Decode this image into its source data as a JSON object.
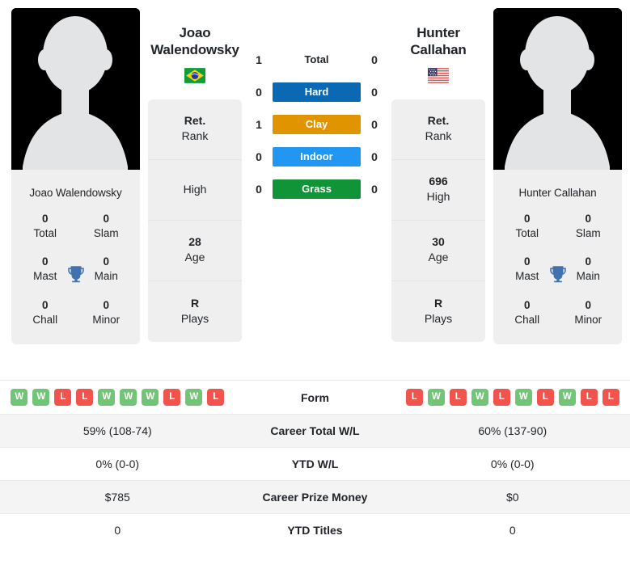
{
  "players": {
    "left": {
      "name": "Joao Walendowsky",
      "first_name": "Joao",
      "last_name": "Walendowsky",
      "country": "Brazil",
      "flag_icon": "flag-brazil-icon",
      "photo_icon": "player-silhouette-icon",
      "trophies": [
        {
          "value": "0",
          "label": "Total"
        },
        {
          "value": "0",
          "label": "Slam"
        },
        {
          "value": "0",
          "label": "Mast"
        },
        {
          "value": "0",
          "label": "Main"
        },
        {
          "value": "0",
          "label": "Chall"
        },
        {
          "value": "0",
          "label": "Minor"
        }
      ],
      "stats": [
        {
          "value": "Ret.",
          "label": "Rank"
        },
        {
          "value": "",
          "label": "High"
        },
        {
          "value": "28",
          "label": "Age"
        },
        {
          "value": "R",
          "label": "Plays"
        }
      ],
      "form": [
        "W",
        "W",
        "L",
        "L",
        "W",
        "W",
        "W",
        "L",
        "W",
        "L"
      ]
    },
    "right": {
      "name": "Hunter Callahan",
      "first_name": "Hunter",
      "last_name": "Callahan",
      "country": "United States",
      "flag_icon": "flag-usa-icon",
      "photo_icon": "player-silhouette-icon",
      "trophies": [
        {
          "value": "0",
          "label": "Total"
        },
        {
          "value": "0",
          "label": "Slam"
        },
        {
          "value": "0",
          "label": "Mast"
        },
        {
          "value": "0",
          "label": "Main"
        },
        {
          "value": "0",
          "label": "Chall"
        },
        {
          "value": "0",
          "label": "Minor"
        }
      ],
      "stats": [
        {
          "value": "Ret.",
          "label": "Rank"
        },
        {
          "value": "696",
          "label": "High"
        },
        {
          "value": "30",
          "label": "Age"
        },
        {
          "value": "R",
          "label": "Plays"
        }
      ],
      "form": [
        "L",
        "W",
        "L",
        "W",
        "L",
        "W",
        "L",
        "W",
        "L",
        "L"
      ]
    }
  },
  "head_to_head": [
    {
      "surface": "Total",
      "left": "1",
      "right": "0",
      "style": "plain",
      "color": ""
    },
    {
      "surface": "Hard",
      "left": "0",
      "right": "0",
      "style": "hard",
      "color": "#0b69b4"
    },
    {
      "surface": "Clay",
      "left": "1",
      "right": "0",
      "style": "clay",
      "color": "#e09400"
    },
    {
      "surface": "Indoor",
      "left": "0",
      "right": "0",
      "style": "indoor",
      "color": "#2196f3"
    },
    {
      "surface": "Grass",
      "left": "0",
      "right": "0",
      "style": "grass",
      "color": "#119438"
    }
  ],
  "trophy_icon": "trophy-icon",
  "trophy_color": "#4172ad",
  "comparison_table": [
    {
      "label": "Form",
      "left": "",
      "right": "",
      "type": "form"
    },
    {
      "label": "Career Total W/L",
      "left": "59% (108-74)",
      "right": "60% (137-90)",
      "type": "text"
    },
    {
      "label": "YTD W/L",
      "left": "0% (0-0)",
      "right": "0% (0-0)",
      "type": "text"
    },
    {
      "label": "Career Prize Money",
      "left": "$785",
      "right": "$0",
      "type": "text"
    },
    {
      "label": "YTD Titles",
      "left": "0",
      "right": "0",
      "type": "text"
    }
  ],
  "colors": {
    "win_badge": "#72c476",
    "loss_badge": "#f0544c",
    "card_bg": "#efefef",
    "row_alt_bg": "#f4f4f5"
  }
}
